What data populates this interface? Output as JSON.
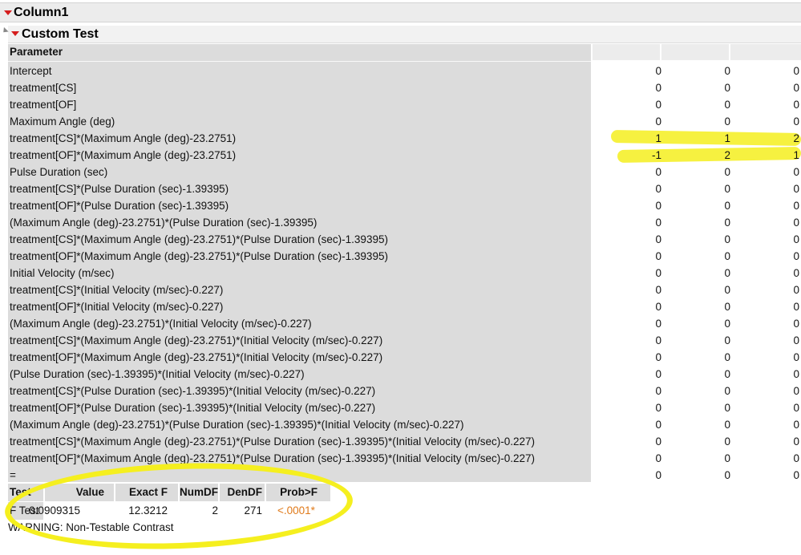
{
  "outline_title": "Column1",
  "report_title": "Custom Test",
  "parameter_header": "Parameter",
  "rows": [
    {
      "param": "Intercept",
      "v1": "0",
      "v2": "0",
      "v3": "0"
    },
    {
      "param": "treatment[CS]",
      "v1": "0",
      "v2": "0",
      "v3": "0"
    },
    {
      "param": "treatment[OF]",
      "v1": "0",
      "v2": "0",
      "v3": "0"
    },
    {
      "param": "Maximum Angle (deg)",
      "v1": "0",
      "v2": "0",
      "v3": "0"
    },
    {
      "param": "treatment[CS]*(Maximum Angle (deg)-23.2751)",
      "v1": "1",
      "v2": "1",
      "v3": "2"
    },
    {
      "param": "treatment[OF]*(Maximum Angle (deg)-23.2751)",
      "v1": "-1",
      "v2": "2",
      "v3": "1"
    },
    {
      "param": "Pulse Duration (sec)",
      "v1": "0",
      "v2": "0",
      "v3": "0"
    },
    {
      "param": "treatment[CS]*(Pulse Duration (sec)-1.39395)",
      "v1": "0",
      "v2": "0",
      "v3": "0"
    },
    {
      "param": "treatment[OF]*(Pulse Duration (sec)-1.39395)",
      "v1": "0",
      "v2": "0",
      "v3": "0"
    },
    {
      "param": "(Maximum Angle (deg)-23.2751)*(Pulse Duration (sec)-1.39395)",
      "v1": "0",
      "v2": "0",
      "v3": "0"
    },
    {
      "param": "treatment[CS]*(Maximum Angle (deg)-23.2751)*(Pulse Duration (sec)-1.39395)",
      "v1": "0",
      "v2": "0",
      "v3": "0"
    },
    {
      "param": "treatment[OF]*(Maximum Angle (deg)-23.2751)*(Pulse Duration (sec)-1.39395)",
      "v1": "0",
      "v2": "0",
      "v3": "0"
    },
    {
      "param": "Initial Velocity (m/sec)",
      "v1": "0",
      "v2": "0",
      "v3": "0"
    },
    {
      "param": "treatment[CS]*(Initial Velocity (m/sec)-0.227)",
      "v1": "0",
      "v2": "0",
      "v3": "0"
    },
    {
      "param": "treatment[OF]*(Initial Velocity (m/sec)-0.227)",
      "v1": "0",
      "v2": "0",
      "v3": "0"
    },
    {
      "param": "(Maximum Angle (deg)-23.2751)*(Initial Velocity (m/sec)-0.227)",
      "v1": "0",
      "v2": "0",
      "v3": "0"
    },
    {
      "param": "treatment[CS]*(Maximum Angle (deg)-23.2751)*(Initial Velocity (m/sec)-0.227)",
      "v1": "0",
      "v2": "0",
      "v3": "0"
    },
    {
      "param": "treatment[OF]*(Maximum Angle (deg)-23.2751)*(Initial Velocity (m/sec)-0.227)",
      "v1": "0",
      "v2": "0",
      "v3": "0"
    },
    {
      "param": "(Pulse Duration (sec)-1.39395)*(Initial Velocity (m/sec)-0.227)",
      "v1": "0",
      "v2": "0",
      "v3": "0"
    },
    {
      "param": "treatment[CS]*(Pulse Duration (sec)-1.39395)*(Initial Velocity (m/sec)-0.227)",
      "v1": "0",
      "v2": "0",
      "v3": "0"
    },
    {
      "param": "treatment[OF]*(Pulse Duration (sec)-1.39395)*(Initial Velocity (m/sec)-0.227)",
      "v1": "0",
      "v2": "0",
      "v3": "0"
    },
    {
      "param": "(Maximum Angle (deg)-23.2751)*(Pulse Duration (sec)-1.39395)*(Initial Velocity (m/sec)-0.227)",
      "v1": "0",
      "v2": "0",
      "v3": "0"
    },
    {
      "param": "treatment[CS]*(Maximum Angle (deg)-23.2751)*(Pulse Duration (sec)-1.39395)*(Initial Velocity (m/sec)-0.227)",
      "v1": "0",
      "v2": "0",
      "v3": "0"
    },
    {
      "param": "treatment[OF]*(Maximum Angle (deg)-23.2751)*(Pulse Duration (sec)-1.39395)*(Initial Velocity (m/sec)-0.227)",
      "v1": "0",
      "v2": "0",
      "v3": "0"
    },
    {
      "param": "=",
      "v1": "0",
      "v2": "0",
      "v3": "0"
    }
  ],
  "ftest": {
    "headers": [
      "Test",
      "Value",
      "Exact F",
      "NumDF",
      "DenDF",
      "Prob>F"
    ],
    "row": [
      "F Test",
      "0.0909315",
      "12.3212",
      "2",
      "271",
      "<.0001*"
    ]
  },
  "warning": "WARNING: Non-Testable Contrast",
  "colors": {
    "highlight": "#f5ef1f",
    "prob_sig": "#e07a1a",
    "disclosure": "#d51d1d"
  }
}
